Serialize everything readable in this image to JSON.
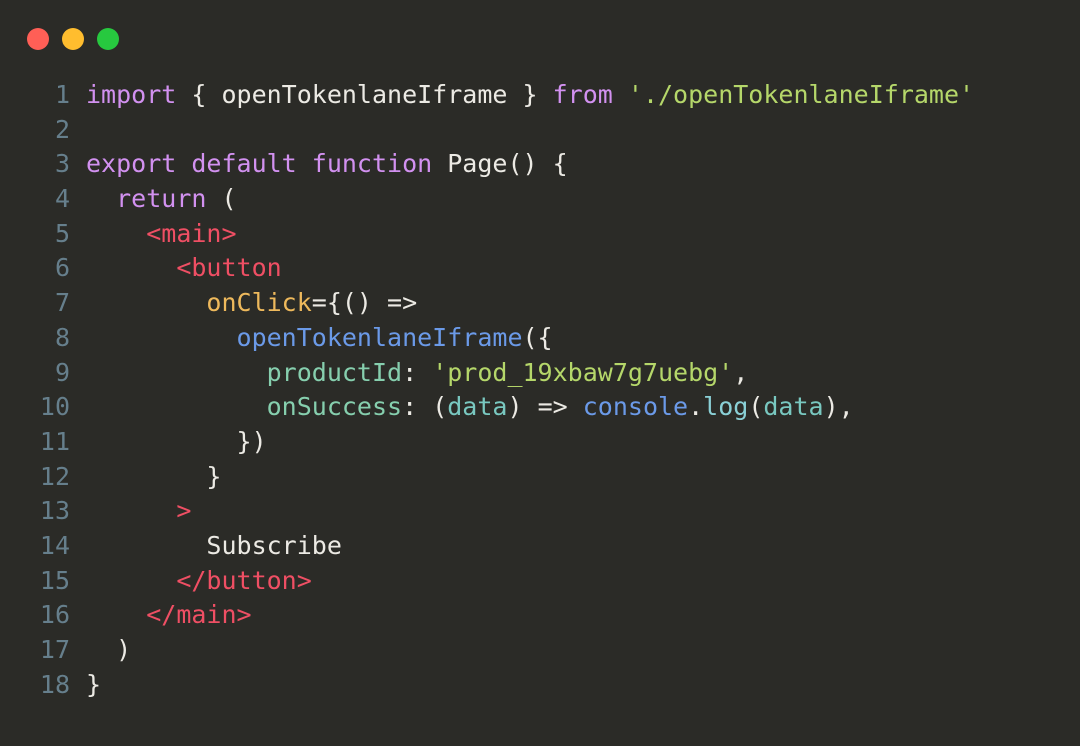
{
  "window": {
    "traffic_lights": [
      {
        "name": "close",
        "color": "#ff5f56"
      },
      {
        "name": "minimize",
        "color": "#ffbd2e"
      },
      {
        "name": "maximize",
        "color": "#27c93f"
      }
    ],
    "background": "#2b2b27"
  },
  "editor": {
    "language": "jsx",
    "line_numbers": [
      "1",
      "2",
      "3",
      "4",
      "5",
      "6",
      "7",
      "8",
      "9",
      "10",
      "11",
      "12",
      "13",
      "14",
      "15",
      "16",
      "17",
      "18"
    ],
    "gutter_color": "#667f8c",
    "plain_text_color": "#eceae4",
    "token_colors": {
      "keyword": "#d291f0",
      "string": "#b5d76a",
      "jsx_tag": "#ef4f64",
      "attribute": "#eeb95c",
      "function": "#6b9ae8",
      "property": "#86cfae",
      "parameter": "#79c8c0",
      "method": "#8ad0d6"
    },
    "lines": [
      {
        "number": "1",
        "plain": "import { openTokenlaneIframe } from './openTokenlaneIframe'",
        "tokens": [
          {
            "t": "import",
            "c": "tok-keyword"
          },
          {
            "t": " { ",
            "c": "tok-plain"
          },
          {
            "t": "openTokenlaneIframe",
            "c": "tok-plain"
          },
          {
            "t": " } ",
            "c": "tok-plain"
          },
          {
            "t": "from",
            "c": "tok-keyword"
          },
          {
            "t": " ",
            "c": "tok-plain"
          },
          {
            "t": "'./openTokenlaneIframe'",
            "c": "tok-string"
          }
        ]
      },
      {
        "number": "2",
        "plain": "",
        "tokens": []
      },
      {
        "number": "3",
        "plain": "export default function Page() {",
        "tokens": [
          {
            "t": "export default function",
            "c": "tok-keyword"
          },
          {
            "t": " ",
            "c": "tok-plain"
          },
          {
            "t": "Page",
            "c": "tok-plain"
          },
          {
            "t": "() {",
            "c": "tok-plain"
          }
        ]
      },
      {
        "number": "4",
        "plain": "  return (",
        "tokens": [
          {
            "t": "  ",
            "c": "tok-plain"
          },
          {
            "t": "return",
            "c": "tok-keyword"
          },
          {
            "t": " (",
            "c": "tok-plain"
          }
        ]
      },
      {
        "number": "5",
        "plain": "    <main>",
        "tokens": [
          {
            "t": "    ",
            "c": "tok-plain"
          },
          {
            "t": "<main>",
            "c": "tok-tag"
          }
        ]
      },
      {
        "number": "6",
        "plain": "      <button",
        "tokens": [
          {
            "t": "      ",
            "c": "tok-plain"
          },
          {
            "t": "<button",
            "c": "tok-tag"
          }
        ]
      },
      {
        "number": "7",
        "plain": "        onClick={() =>",
        "tokens": [
          {
            "t": "        ",
            "c": "tok-plain"
          },
          {
            "t": "onClick",
            "c": "tok-attr"
          },
          {
            "t": "={() =>",
            "c": "tok-plain"
          }
        ]
      },
      {
        "number": "8",
        "plain": "          openTokenlaneIframe({",
        "tokens": [
          {
            "t": "          ",
            "c": "tok-plain"
          },
          {
            "t": "openTokenlaneIframe",
            "c": "tok-func"
          },
          {
            "t": "({",
            "c": "tok-plain"
          }
        ]
      },
      {
        "number": "9",
        "plain": "            productId: 'prod_19xbaw7g7uebg',",
        "tokens": [
          {
            "t": "            ",
            "c": "tok-plain"
          },
          {
            "t": "productId",
            "c": "tok-prop"
          },
          {
            "t": ": ",
            "c": "tok-plain"
          },
          {
            "t": "'prod_19xbaw7g7uebg'",
            "c": "tok-string"
          },
          {
            "t": ",",
            "c": "tok-plain"
          }
        ]
      },
      {
        "number": "10",
        "plain": "            onSuccess: (data) => console.log(data),",
        "tokens": [
          {
            "t": "            ",
            "c": "tok-plain"
          },
          {
            "t": "onSuccess",
            "c": "tok-prop"
          },
          {
            "t": ": (",
            "c": "tok-plain"
          },
          {
            "t": "data",
            "c": "tok-param"
          },
          {
            "t": ") => ",
            "c": "tok-plain"
          },
          {
            "t": "console",
            "c": "tok-object"
          },
          {
            "t": ".",
            "c": "tok-plain"
          },
          {
            "t": "log",
            "c": "tok-method"
          },
          {
            "t": "(",
            "c": "tok-plain"
          },
          {
            "t": "data",
            "c": "tok-param"
          },
          {
            "t": "),",
            "c": "tok-plain"
          }
        ]
      },
      {
        "number": "11",
        "plain": "          })",
        "tokens": [
          {
            "t": "          })",
            "c": "tok-plain"
          }
        ]
      },
      {
        "number": "12",
        "plain": "        }",
        "tokens": [
          {
            "t": "        }",
            "c": "tok-plain"
          }
        ]
      },
      {
        "number": "13",
        "plain": "      >",
        "tokens": [
          {
            "t": "      ",
            "c": "tok-plain"
          },
          {
            "t": ">",
            "c": "tok-tag"
          }
        ]
      },
      {
        "number": "14",
        "plain": "        Subscribe",
        "tokens": [
          {
            "t": "        Subscribe",
            "c": "tok-plain"
          }
        ]
      },
      {
        "number": "15",
        "plain": "      </button>",
        "tokens": [
          {
            "t": "      ",
            "c": "tok-plain"
          },
          {
            "t": "</button>",
            "c": "tok-tag"
          }
        ]
      },
      {
        "number": "16",
        "plain": "    </main>",
        "tokens": [
          {
            "t": "    ",
            "c": "tok-plain"
          },
          {
            "t": "</main>",
            "c": "tok-tag"
          }
        ]
      },
      {
        "number": "17",
        "plain": "  )",
        "tokens": [
          {
            "t": "  )",
            "c": "tok-plain"
          }
        ]
      },
      {
        "number": "18",
        "plain": "}",
        "tokens": [
          {
            "t": "}",
            "c": "tok-plain"
          }
        ]
      }
    ]
  }
}
